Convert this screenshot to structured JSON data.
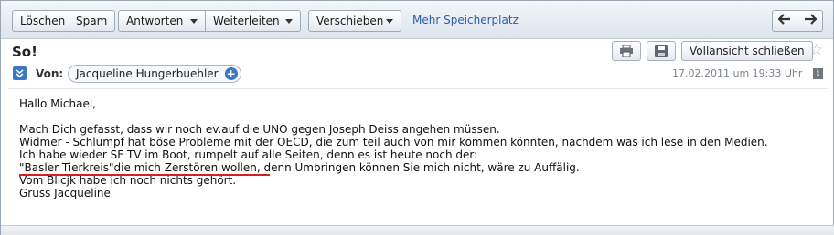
{
  "toolbar": {
    "delete_label": "Löschen",
    "spam_label": "Spam",
    "reply_label": "Antworten",
    "forward_label": "Weiterleiten",
    "move_label": "Verschieben",
    "more_storage_label": "Mehr Speicherplatz",
    "prev_icon": "arrow-left-icon",
    "next_icon": "arrow-right-icon"
  },
  "message": {
    "subject": "So!",
    "print_icon": "printer-icon",
    "save_icon": "floppy-disk-icon",
    "close_fullview_label": "Vollansicht schließen",
    "star_icon": "star-icon",
    "from_label": "Von:",
    "sender_name": "Jacqueline Hungerbuehler",
    "date": "17.02.2011 um 19:33 Uhr",
    "info_icon": "info-icon",
    "accent_color": "#3a78c4"
  },
  "body": {
    "greeting": "Hallo Michael,",
    "lines": [
      "Mach Dich gefasst, dass wir noch ev.auf die UNO gegen Joseph Deiss angehen müssen.",
      "Widmer - Schlumpf hat böse Probleme mit der OECD, die zum teil auch von mir kommen könnten, nachdem was ich lese in den Medien.",
      "Ich habe wieder SF TV im Boot, rumpelt auf alle Seiten, denn es ist heute noch der:",
      "\"Basler Tierkreis\"die mich Zerstören wollen, denn Umbringen können Sie mich nicht, wäre zu Auffälig.",
      "Vom Blicjk habe ich noch nichts gehört.",
      "Gruss Jacqueline"
    ],
    "underline_color": "#d42020"
  }
}
